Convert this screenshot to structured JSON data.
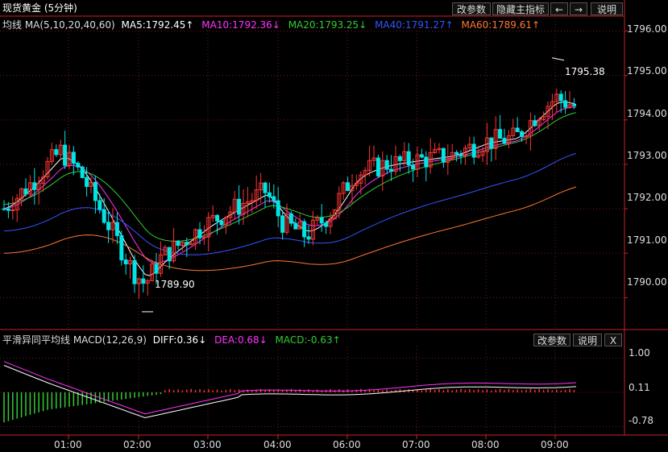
{
  "header": {
    "title": "现货黄金 (5分钟)",
    "buttons": [
      "改参数",
      "隐藏主指标",
      "←",
      "→",
      "说明"
    ]
  },
  "ma_legend": {
    "title": "均线 MA(5,10,20,40,60)",
    "items": [
      {
        "text": "MA5:1792.45↑",
        "color": "#ffffff"
      },
      {
        "text": "MA10:1792.36↓",
        "color": "#ff33ff"
      },
      {
        "text": "MA20:1793.25↓",
        "color": "#33cc33"
      },
      {
        "text": "MA40:1791.27↑",
        "color": "#3355ff"
      },
      {
        "text": "MA60:1789.61↑",
        "color": "#ff7733"
      }
    ]
  },
  "macd_legend": {
    "title": "平滑异同平均线 MACD(12,26,9)",
    "items": [
      {
        "text": "DIFF:0.36↓",
        "color": "#ffffff"
      },
      {
        "text": "DEA:0.68↓",
        "color": "#ff33ff"
      },
      {
        "text": "MACD:-0.63↑",
        "color": "#33cc33"
      }
    ],
    "buttons": [
      "改参数",
      "说明",
      "X"
    ]
  },
  "annotations": {
    "high": "1795.38",
    "low": "1789.90"
  },
  "colors": {
    "up": "#ff3333",
    "down": "#00e5e5",
    "grid": "#7a1a1a",
    "axis": "#cc2222"
  },
  "chart_data": [
    {
      "type": "candlestick",
      "title": "现货黄金 (5分钟)",
      "x_ticks": [
        "01:00",
        "02:00",
        "03:00",
        "04:00",
        "06:00",
        "07:00",
        "08:00",
        "09:00"
      ],
      "y_ticks": [
        "1796.00",
        "1795.00",
        "1794.00",
        "1793.00",
        "1792.00",
        "1791.00",
        "1790.00"
      ],
      "ylim": [
        1789.3,
        1796.3
      ],
      "grid": true,
      "series": [
        {
          "name": "MA5",
          "value": 1792.45
        },
        {
          "name": "MA10",
          "value": 1792.36
        },
        {
          "name": "MA20",
          "value": 1793.25
        },
        {
          "name": "MA40",
          "value": 1791.27
        },
        {
          "name": "MA60",
          "value": 1789.61
        }
      ],
      "high": 1795.38,
      "low": 1789.9
    },
    {
      "type": "bar",
      "title": "平滑异同平均线 MACD(12,26,9)",
      "y_ticks": [
        "1.00",
        "0.11",
        "-0.78"
      ],
      "ylim": [
        -1.0,
        1.3
      ],
      "series": [
        {
          "name": "DIFF",
          "value": 0.36
        },
        {
          "name": "DEA",
          "value": 0.68
        },
        {
          "name": "MACD",
          "value": -0.63
        }
      ]
    }
  ]
}
